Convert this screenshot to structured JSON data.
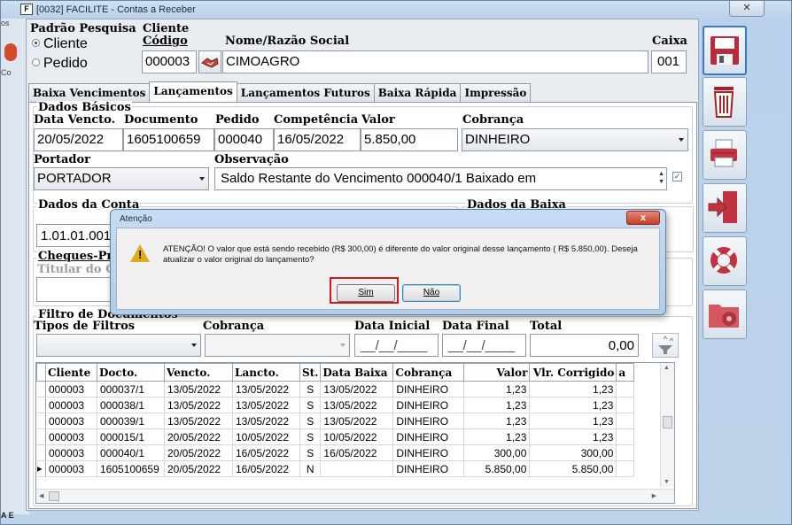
{
  "window": {
    "title": "[0032] FACILITE - Contas a Receber",
    "close_glyph": "✕",
    "app_icon": "F"
  },
  "side": {
    "os": "os",
    "co": "Co",
    "ae": "A E"
  },
  "search_mode": {
    "heading": "Padrão Pesquisa",
    "option_client": "Cliente",
    "option_order": "Pedido"
  },
  "client": {
    "heading": "Cliente",
    "code_label": "Código",
    "code": "000003",
    "name_label": "Nome/Razão Social",
    "name": "CIMOAGRO"
  },
  "cashbox": {
    "label": "Caixa",
    "value": "001"
  },
  "tabs": [
    "Baixa Vencimentos",
    "Lançamentos",
    "Lançamentos Futuros",
    "Baixa Rápida",
    "Impressão"
  ],
  "basic": {
    "heading": "Dados Básicos",
    "due_label": "Data Vencto.",
    "due": "20/05/2022",
    "doc_label": "Documento",
    "doc": "1605100659",
    "order_label": "Pedido",
    "order": "000040",
    "comp_label": "Competência",
    "comp": "16/05/2022",
    "value_label": "Valor",
    "value": "5.850,00",
    "billing_label": "Cobrança",
    "billing": "DINHEIRO",
    "bearer_label": "Portador",
    "bearer": "PORTADOR",
    "obs_label": "Observação",
    "obs": "Saldo Restante do Vencimento 000040/1 Baixado em"
  },
  "account": {
    "heading": "Dados da Conta",
    "value": "1.01.01.001"
  },
  "writeoff": {
    "heading": "Dados da Baixa"
  },
  "cheques": {
    "heading": "Cheques-Pré",
    "holder_label": "Titular do Ch"
  },
  "filter": {
    "heading": "Filtro de Documentos",
    "types_label": "Tipos de Filtros",
    "billing_label": "Cobrança",
    "start_label": "Data Inicial",
    "start": "__/__/____",
    "end_label": "Data Final",
    "end": "__/__/____",
    "total_label": "Total",
    "total": "0,00"
  },
  "grid": {
    "headers": [
      "Cliente",
      "Docto.",
      "Vencto.",
      "Lancto.",
      "St.",
      "Data Baixa",
      "Cobrança",
      "Valor",
      "Vlr. Corrigido",
      "a"
    ],
    "rows": [
      [
        "000003",
        "000037/1",
        "13/05/2022",
        "13/05/2022",
        "S",
        "13/05/2022",
        "DINHEIRO",
        "1,23",
        "1,23"
      ],
      [
        "000003",
        "000038/1",
        "13/05/2022",
        "13/05/2022",
        "S",
        "13/05/2022",
        "DINHEIRO",
        "1,23",
        "1,23"
      ],
      [
        "000003",
        "000039/1",
        "13/05/2022",
        "13/05/2022",
        "S",
        "13/05/2022",
        "DINHEIRO",
        "1,23",
        "1,23"
      ],
      [
        "000003",
        "000015/1",
        "20/05/2022",
        "10/05/2022",
        "S",
        "10/05/2022",
        "DINHEIRO",
        "1,23",
        "1,23"
      ],
      [
        "000003",
        "000040/1",
        "20/05/2022",
        "16/05/2022",
        "S",
        "16/05/2022",
        "DINHEIRO",
        "300,00",
        "300,00"
      ],
      [
        "000003",
        "1605100659",
        "20/05/2022",
        "16/05/2022",
        "N",
        "",
        "DINHEIRO",
        "5.850,00",
        "5.850,00"
      ]
    ]
  },
  "dialog": {
    "title": "Atenção",
    "icon": "!",
    "message": "ATENÇÃO! O valor que está sendo recebido (R$ 300,00) é diferente do valor original desse lançamento ( R$ 5.850,00). Deseja atualizar o valor original do lançamento?",
    "yes": "Sim",
    "no": "Não",
    "close": "x"
  },
  "colors": {
    "accent": "#3a78c9",
    "highlight": "#d81818",
    "warning": "#e2a91b"
  }
}
